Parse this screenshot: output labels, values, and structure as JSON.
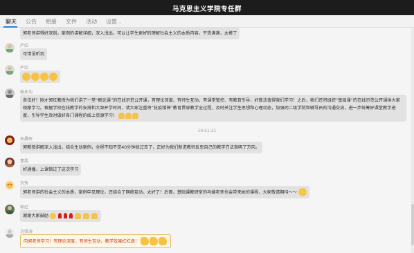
{
  "window": {
    "title": "马克思主义学院专任群"
  },
  "tabs": [
    {
      "label": "聊天"
    },
    {
      "label": "公告"
    },
    {
      "label": "相册"
    },
    {
      "label": "文件"
    },
    {
      "label": "活动"
    },
    {
      "label": "设置"
    }
  ],
  "messages": [
    {
      "sender": "",
      "text": "郭老师讲得好深刻，案例的讲解详细，深入浅出，可以让学生更好的理解社会主义的本质内容，干货满满，太棒了"
    },
    {
      "sender": "严红",
      "text": "可惜没听到"
    },
    {
      "sender": "严红",
      "text": ""
    },
    {
      "sender": "喻永均",
      "text": "各位好！刚才郭红教授为我们讲了一堂“概论课”的在线示范公开课，有理论深度、有师生互动、有课堂管控、有教育引导，好做法值得我们学习！之后，我们还将组织“基础课”的在线示范公开课供大家观摩学习。根据学校在线教学的安排和大致开学时间，请大家注重将“抗疫精神”教育贯穿教学全过程，及时关注学生思想和心理动态，加强同二级学院和辅导员的沟通交流，进一步统筹好课堂教学进度，引导学生及时做好各门课程的线上资源学习！"
    },
    {
      "sender": "宋晨晖",
      "text": "郭教授讲解深入浅出，结合生动案例，全程不知不觉40分钟就过去了，正好为我们新进教师反思自己的教学方法指明了方向。"
    },
    {
      "sender": "董霞",
      "text": "好通播，上课错过了这次学习"
    },
    {
      "sender": "刘秀",
      "text": "郭老师讲的社会主义的本质，案例中见理论，还结合了网络互动，太好了！后面，基础课教研室的马嫂老师也会带来她的课程，大家敬请期待～～"
    },
    {
      "sender": "熊红",
      "text": "谢谢大家鼓励"
    },
    {
      "sender": "刘贤涛",
      "text": "向郭老师学习！有理论深度，有师生互动，教学效果杠杠滴！"
    }
  ],
  "timestamp": "10:51:21",
  "colors": {
    "titlebar": "#1c1c1c",
    "active_tab": "#2b7be5",
    "bubble": "#e2e2e2",
    "highlight_text": "#c8421e",
    "highlight_border": "#e4b75b"
  }
}
